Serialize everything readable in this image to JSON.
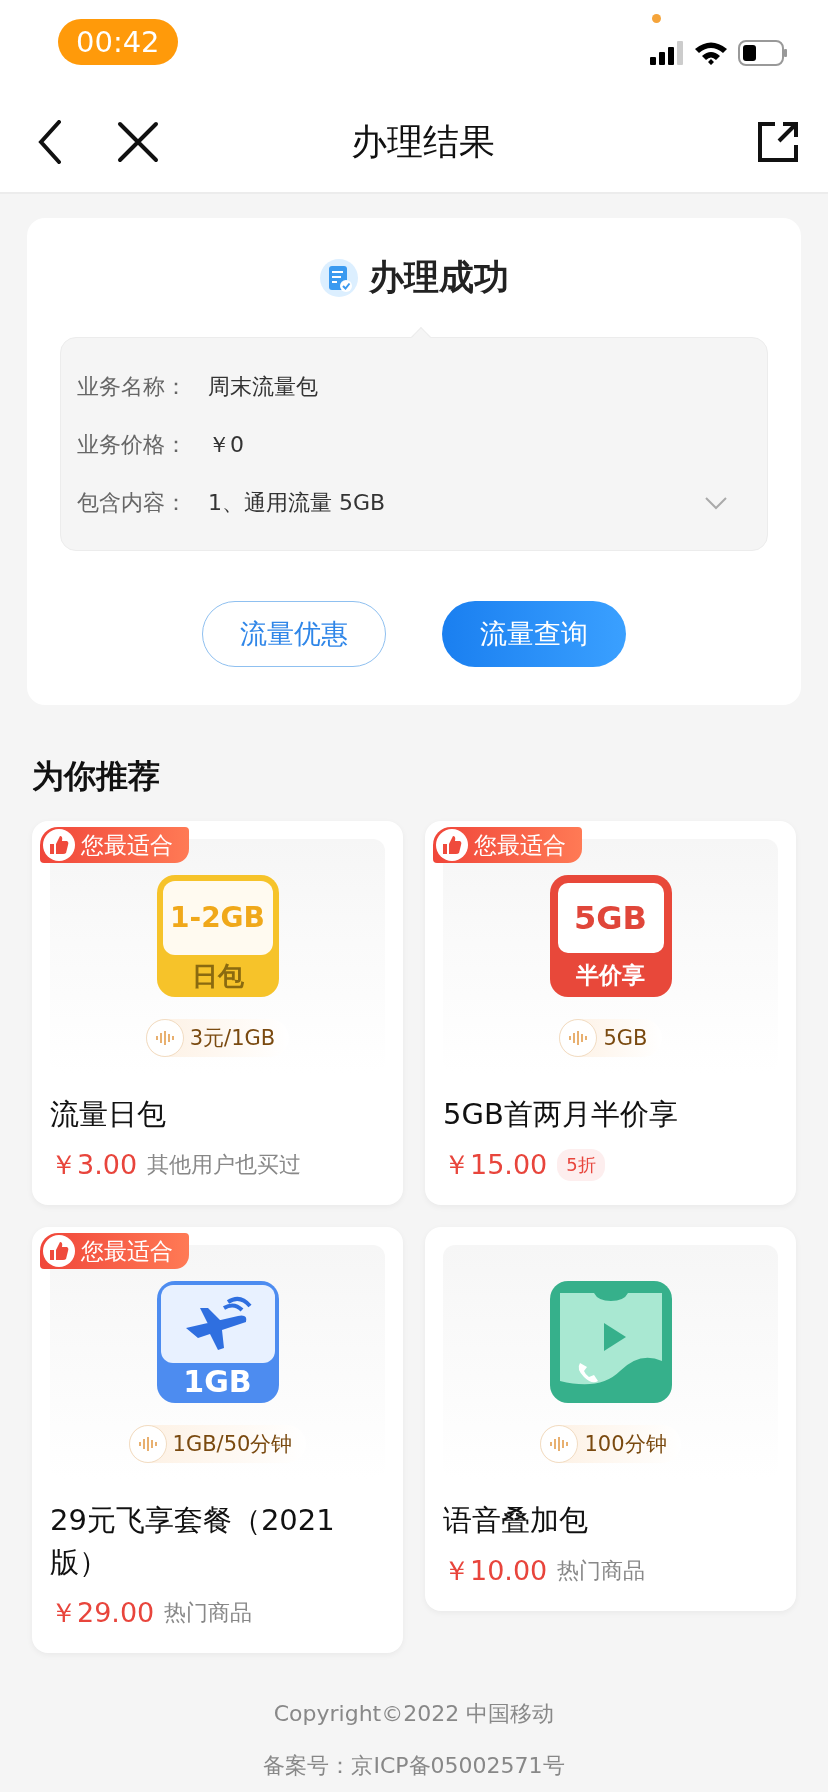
{
  "status_bar": {
    "time": "00:42"
  },
  "nav": {
    "title": "办理结果"
  },
  "result": {
    "title": "办理成功",
    "expanded": false,
    "details": [
      {
        "label": "业务名称：",
        "value": "周末流量包"
      },
      {
        "label": "业务价格：",
        "value": "￥0"
      },
      {
        "label": "包含内容：",
        "value": "1、通用流量 5GB"
      }
    ],
    "buttons": [
      {
        "label": "流量优惠",
        "kind": "outline"
      },
      {
        "label": "流量查询",
        "kind": "primary"
      }
    ]
  },
  "recommend": {
    "title": "为你推荐",
    "products": [
      {
        "badge": "您最适合",
        "icon": {
          "kind": "daily",
          "top": "1-2GB",
          "bottom": "日包"
        },
        "spec": "3元/1GB",
        "name": "流量日包",
        "price": "￥3.00",
        "note": {
          "kind": "text",
          "text": "其他用户也买过"
        }
      },
      {
        "badge": "您最适合",
        "icon": {
          "kind": "half",
          "top": "5GB",
          "bottom": "半价享"
        },
        "spec": "5GB",
        "name": "5GB首两月半价享",
        "price": "￥15.00",
        "note": {
          "kind": "discount",
          "text": "5折"
        }
      },
      {
        "badge": "您最适合",
        "icon": {
          "kind": "flight",
          "bottom": "1GB"
        },
        "spec": "1GB/50分钟",
        "name": "29元飞享套餐（2021版）",
        "price": "￥29.00",
        "note": {
          "kind": "text",
          "text": "热门商品"
        }
      },
      {
        "icon": {
          "kind": "voice"
        },
        "spec": "100分钟",
        "name": "语音叠加包",
        "price": "￥10.00",
        "note": {
          "kind": "text",
          "text": "热门商品"
        }
      }
    ]
  },
  "footer": [
    "Copyright©2022 中国移动",
    "备案号：京ICP备05002571号"
  ]
}
